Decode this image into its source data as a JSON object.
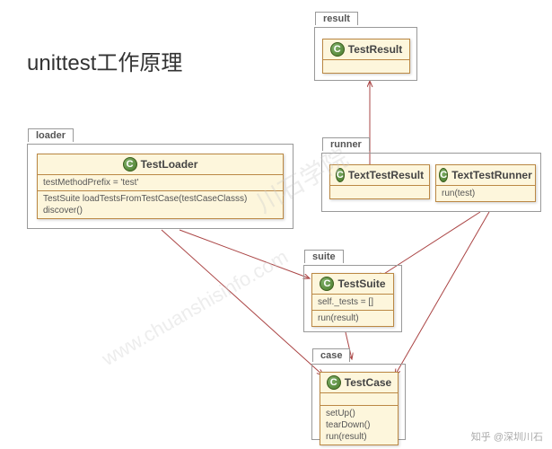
{
  "title": "unittest工作原理",
  "packages": {
    "result": {
      "label": "result"
    },
    "loader": {
      "label": "loader"
    },
    "runner": {
      "label": "runner"
    },
    "suite": {
      "label": "suite"
    },
    "case": {
      "label": "case"
    }
  },
  "classes": {
    "TestResult": {
      "name": "TestResult",
      "icon": "C"
    },
    "TestLoader": {
      "name": "TestLoader",
      "icon": "C",
      "attributes": "testMethodPrefix = 'test'",
      "methods": "TestSuite loadTestsFromTestCase(testCaseClasss)\ndiscover()"
    },
    "TextTestResult": {
      "name": "TextTestResult",
      "icon": "C"
    },
    "TextTestRunner": {
      "name": "TextTestRunner",
      "icon": "C",
      "methods": "run(test)"
    },
    "TestSuite": {
      "name": "TestSuite",
      "icon": "C",
      "attributes": "self._tests = []",
      "methods": "run(result)"
    },
    "TestCase": {
      "name": "TestCase",
      "icon": "C",
      "methods": "setUp()\ntearDown()\nrun(result)"
    }
  },
  "watermark": {
    "text1": "川石学院",
    "text2": "www.chuanshisinfo.com"
  },
  "attribution": "知乎 @深圳川石"
}
